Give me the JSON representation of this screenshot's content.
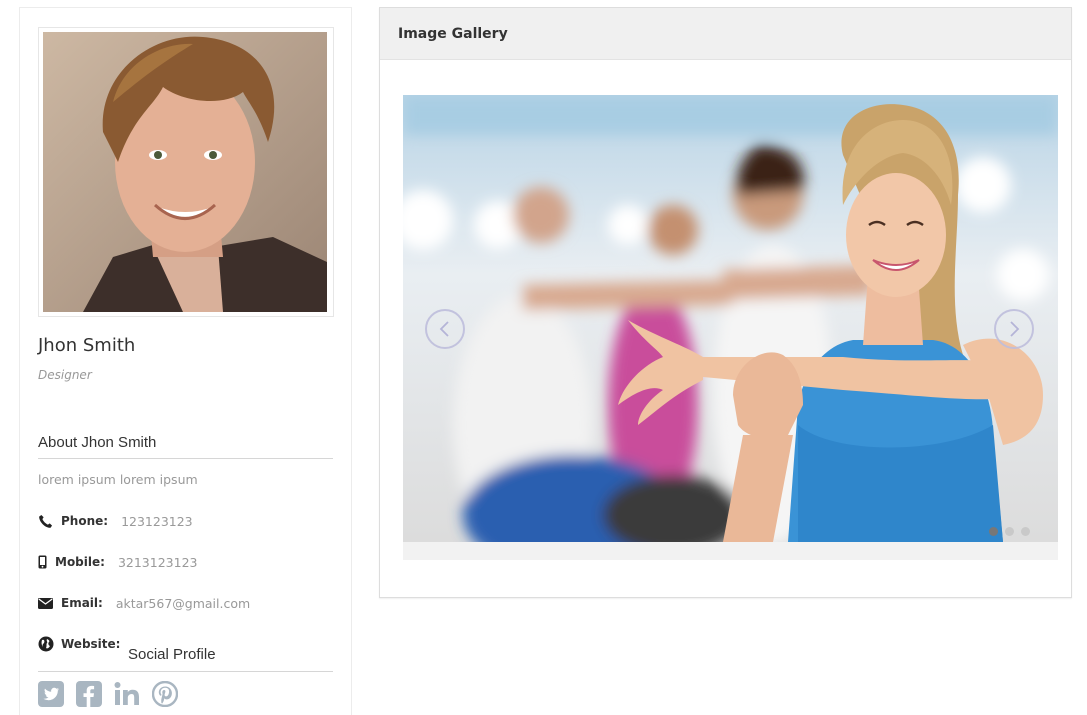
{
  "profile": {
    "name": "Jhon Smith",
    "role": "Designer",
    "about_title": "About Jhon Smith",
    "about_text": "lorem ipsum lorem ipsum",
    "info": [
      {
        "icon": "phone-icon",
        "label": "Phone:",
        "value": "123123123"
      },
      {
        "icon": "mobile-icon",
        "label": "Mobile:",
        "value": "3213123123"
      },
      {
        "icon": "envelope-icon",
        "label": "Email:",
        "value": "aktar567@gmail.com"
      },
      {
        "icon": "globe-icon",
        "label": "Website:",
        "value": ""
      }
    ],
    "social_title": "Social Profile",
    "social": [
      "twitter-icon",
      "facebook-icon",
      "linkedin-icon",
      "pinterest-icon"
    ]
  },
  "gallery": {
    "title": "Image Gallery",
    "slides_count": 3,
    "active_slide": 1
  },
  "colors": {
    "icon_gray": "#a9b6c1",
    "panel_head": "#f0f0f0",
    "muted_text": "#999999"
  }
}
